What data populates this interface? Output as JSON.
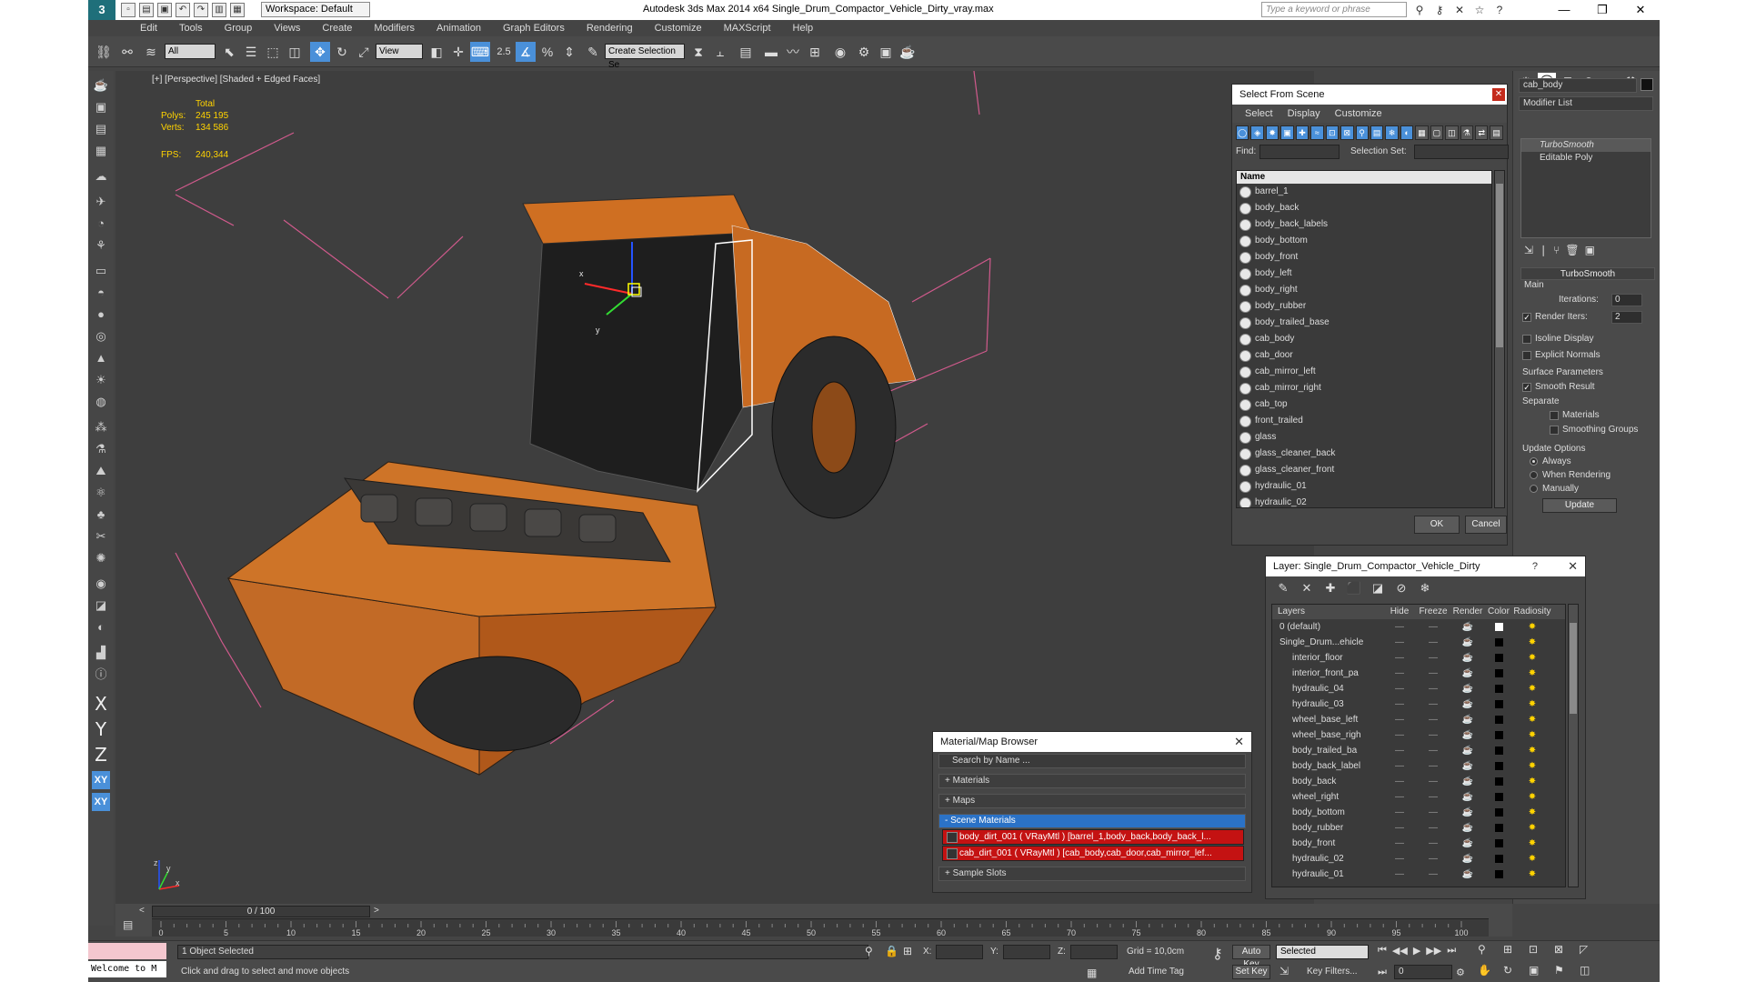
{
  "titlebar": {
    "logo": "3",
    "workspace": "Workspace: Default",
    "title": "Autodesk 3ds Max  2014 x64     Single_Drum_Compactor_Vehicle_Dirty_vray.max",
    "search_placeholder": "Type a keyword or phrase",
    "min": "—",
    "max": "❐",
    "close": "✕"
  },
  "menu": [
    "Edit",
    "Tools",
    "Group",
    "Views",
    "Create",
    "Modifiers",
    "Animation",
    "Graph Editors",
    "Rendering",
    "Customize",
    "MAXScript",
    "Help"
  ],
  "toolbar": {
    "selection_filter": "All",
    "ref_coord": "View",
    "named_sel": "Create Selection Se",
    "snap_label": "2.5"
  },
  "viewport": {
    "label": "[+] [Perspective] [Shaded + Edged Faces]",
    "stats_total": "Total",
    "polys_label": "Polys:",
    "polys_value": "245 195",
    "verts_label": "Verts:",
    "verts_value": "134 586",
    "fps_label": "FPS:",
    "fps_value": "240,344",
    "gizmo_x": "x",
    "gizmo_y": "y",
    "axis_y": "y",
    "axis_z": "z",
    "axis_x": "x"
  },
  "left_toolbar": {
    "x": "X",
    "y": "Y",
    "z": "Z",
    "xy": "XY",
    "xy2": "XY"
  },
  "select_from_scene": {
    "title": "Select From Scene",
    "menus": [
      "Select",
      "Display",
      "Customize"
    ],
    "find_label": "Find:",
    "selset_label": "Selection Set:",
    "col_name": "Name",
    "items": [
      "barrel_1",
      "body_back",
      "body_back_labels",
      "body_bottom",
      "body_front",
      "body_left",
      "body_right",
      "body_rubber",
      "body_trailed_base",
      "cab_body",
      "cab_door",
      "cab_mirror_left",
      "cab_mirror_right",
      "cab_top",
      "front_trailed",
      "glass",
      "glass_cleaner_back",
      "glass_cleaner_front",
      "hydraulic_01",
      "hydraulic_02"
    ],
    "ok": "OK",
    "cancel": "Cancel"
  },
  "layer_dialog": {
    "title": "Layer: Single_Drum_Compactor_Vehicle_Dirty",
    "help": "?",
    "columns": {
      "layers": "Layers",
      "hide": "Hide",
      "freeze": "Freeze",
      "render": "Render",
      "color": "Color",
      "radiosity": "Radiosity"
    },
    "rows": [
      {
        "name": "0 (default)",
        "indent": 1
      },
      {
        "name": "Single_Drum...ehicle",
        "indent": 1
      },
      {
        "name": "interior_floor",
        "indent": 2
      },
      {
        "name": "interior_front_pa",
        "indent": 2
      },
      {
        "name": "hydraulic_04",
        "indent": 2
      },
      {
        "name": "hydraulic_03",
        "indent": 2
      },
      {
        "name": "wheel_base_left",
        "indent": 2
      },
      {
        "name": "wheel_base_righ",
        "indent": 2
      },
      {
        "name": "body_trailed_ba",
        "indent": 2
      },
      {
        "name": "body_back_label",
        "indent": 2
      },
      {
        "name": "body_back",
        "indent": 2
      },
      {
        "name": "wheel_right",
        "indent": 2
      },
      {
        "name": "body_bottom",
        "indent": 2
      },
      {
        "name": "body_rubber",
        "indent": 2
      },
      {
        "name": "body_front",
        "indent": 2
      },
      {
        "name": "hydraulic_02",
        "indent": 2
      },
      {
        "name": "hydraulic_01",
        "indent": 2
      }
    ]
  },
  "material_browser": {
    "title": "Material/Map Browser",
    "search": "Search by Name ...",
    "materials": "+ Materials",
    "maps": "+ Maps",
    "scene_materials": "- Scene Materials",
    "mat1": "body_dirt_001 ( VRayMtl ) [barrel_1,body_back,body_back_l...",
    "mat2": "cab_dirt_001 ( VRayMtl ) [cab_body,cab_door,cab_mirror_lef...",
    "sample_slots": "+ Sample Slots"
  },
  "command_panel": {
    "object_name": "cab_body",
    "modifier_list": "Modifier List",
    "stack": [
      "TurboSmooth",
      "Editable Poly"
    ],
    "rollout_title": "TurboSmooth",
    "main": "Main",
    "iterations_label": "Iterations:",
    "iterations": "0",
    "render_iters_label": "Render Iters:",
    "render_iters": "2",
    "isoline": "Isoline Display",
    "explicit_normals": "Explicit Normals",
    "surface_params": "Surface Parameters",
    "smooth_result": "Smooth Result",
    "separate": "Separate",
    "materials": "Materials",
    "smoothing_groups": "Smoothing Groups",
    "update_options": "Update Options",
    "always": "Always",
    "when_rendering": "When Rendering",
    "manually": "Manually",
    "update": "Update"
  },
  "timeline": {
    "slider": "0 / 100",
    "ticks": [
      "0",
      "5",
      "10",
      "15",
      "20",
      "25",
      "30",
      "35",
      "40",
      "45",
      "50",
      "55",
      "60",
      "65",
      "70",
      "75",
      "80",
      "85",
      "90",
      "95",
      "100"
    ]
  },
  "statusbar": {
    "maxscript": "Welcome to M",
    "selected": "1 Object Selected",
    "prompt": "Click and drag to select and move objects",
    "x_label": "X:",
    "y_label": "Y:",
    "z_label": "Z:",
    "grid": "Grid = 10,0cm",
    "add_time_tag": "Add Time Tag",
    "auto_key": "Auto Key",
    "set_key": "Set Key",
    "selected_dd": "Selected",
    "key_filters": "Key Filters...",
    "frame": "0"
  }
}
